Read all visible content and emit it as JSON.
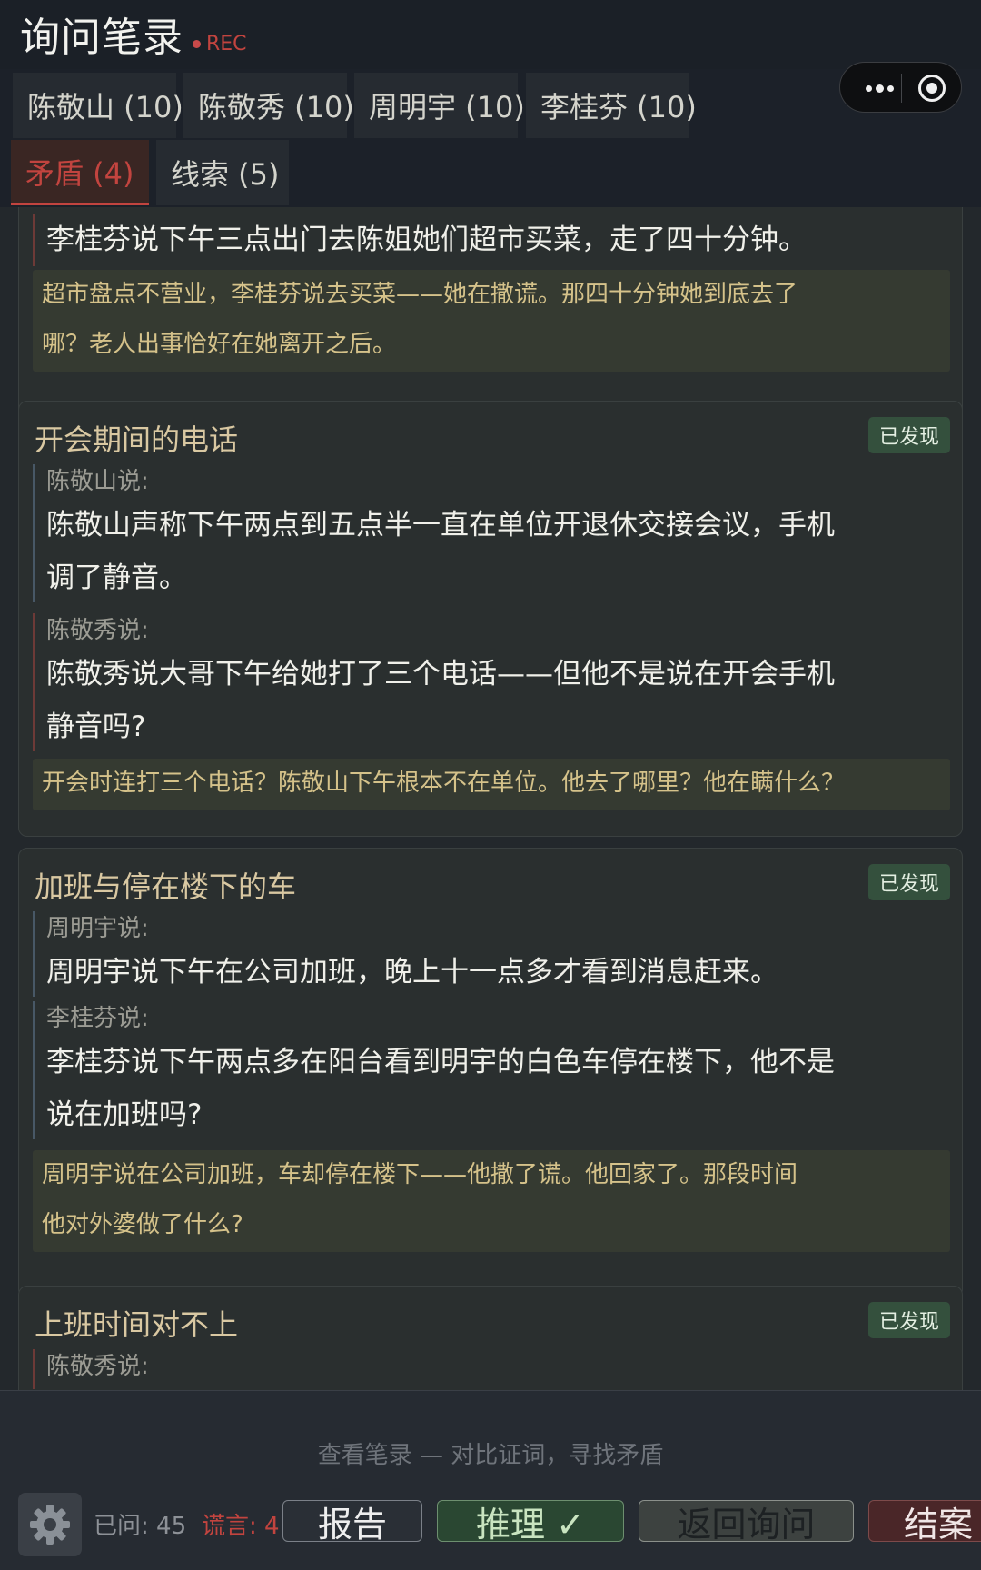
{
  "header": {
    "title": "询问笔录",
    "rec_label": "REC"
  },
  "tabs": [
    {
      "label": "陈敬山 (10)"
    },
    {
      "label": "陈敬秀 (10)"
    },
    {
      "label": "周明宇 (10)"
    },
    {
      "label": "李桂芬 (10)"
    },
    {
      "label": "矛盾 (4)"
    },
    {
      "label": "线索 (5)"
    }
  ],
  "cards": [
    {
      "statements": [
        {
          "text": "李桂芬说下午三点出门去陈姐她们超市买菜，走了四十分钟。"
        }
      ],
      "note": [
        "超市盘点不营业，李桂芬说去买菜——她在撒谎。那四十分钟她到底去了",
        "哪？老人出事恰好在她离开之后。"
      ]
    },
    {
      "title": "开会期间的电话",
      "badge": "已发现",
      "statements": [
        {
          "speaker": "陈敬山说:",
          "lines": [
            "陈敬山声称下午两点到五点半一直在单位开退休交接会议，手机",
            "调了静音。"
          ]
        },
        {
          "speaker": "陈敬秀说:",
          "lines": [
            "陈敬秀说大哥下午给她打了三个电话——但他不是说在开会手机",
            "静音吗?"
          ]
        }
      ],
      "note": [
        "开会时连打三个电话？陈敬山下午根本不在单位。他去了哪里？他在瞒什么？"
      ]
    },
    {
      "title": "加班与停在楼下的车",
      "badge": "已发现",
      "statements": [
        {
          "speaker": "周明宇说:",
          "lines": [
            "周明宇说下午在公司加班，晚上十一点多才看到消息赶来。"
          ]
        },
        {
          "speaker": "李桂芬说:",
          "lines": [
            "李桂芬说下午两点多在阳台看到明宇的白色车停在楼下，他不是",
            "说在加班吗?"
          ]
        }
      ],
      "note": [
        "周明宇说在公司加班，车却停在楼下——他撒了谎。他回家了。那段时间",
        "他对外婆做了什么?"
      ]
    },
    {
      "title": "上班时间对不上",
      "badge": "已发现",
      "statements": [
        {
          "speaker": "陈敬秀说:"
        }
      ]
    }
  ],
  "bottom": {
    "hint": "查看笔录 — 对比证词，寻找矛盾",
    "asked": "已问: 45",
    "lies": "谎言: 4",
    "report": "报告",
    "reason": "推理 ✓",
    "back": "返回询问",
    "close": "结案"
  },
  "colors": {
    "accent_red": "#c2443f",
    "card_title": "#d9c8a2",
    "note_text": "#d5c28a",
    "badge_bg": "#34503d"
  },
  "icons": {
    "settings": "gear-icon",
    "menu": "more-dots-icon",
    "miniapp": "target-icon"
  }
}
